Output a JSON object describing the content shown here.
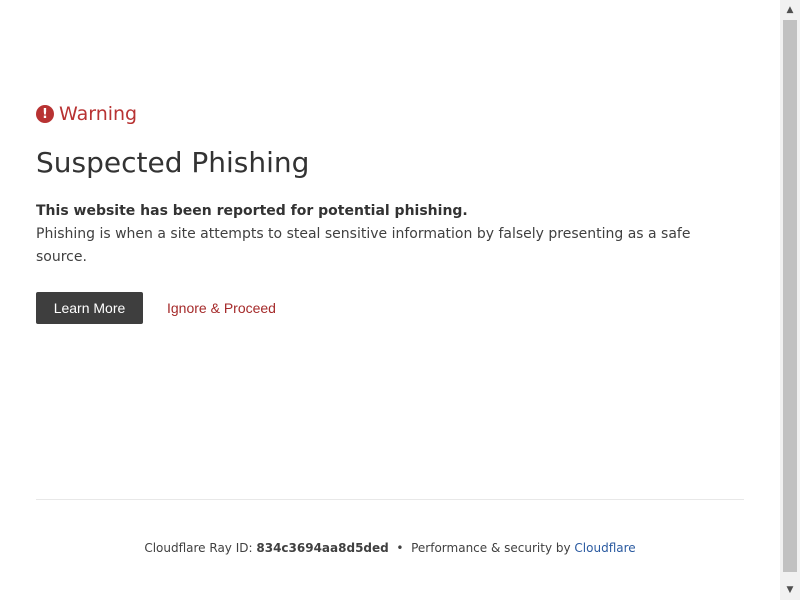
{
  "warning": {
    "icon": "exclamation-circle-icon",
    "label": "Warning",
    "color": "#b83232"
  },
  "title": "Suspected Phishing",
  "description": {
    "strong": "This website has been reported for potential phishing.",
    "body": "Phishing is when a site attempts to steal sensitive information by falsely presenting as a safe source."
  },
  "actions": {
    "learn_more": "Learn More",
    "ignore": "Ignore & Proceed"
  },
  "footer": {
    "ray_prefix": "Cloudflare Ray ID:",
    "ray_id": "834c3694aa8d5ded",
    "separator": "•",
    "perf_text": "Performance & security by",
    "cf_link": "Cloudflare"
  }
}
